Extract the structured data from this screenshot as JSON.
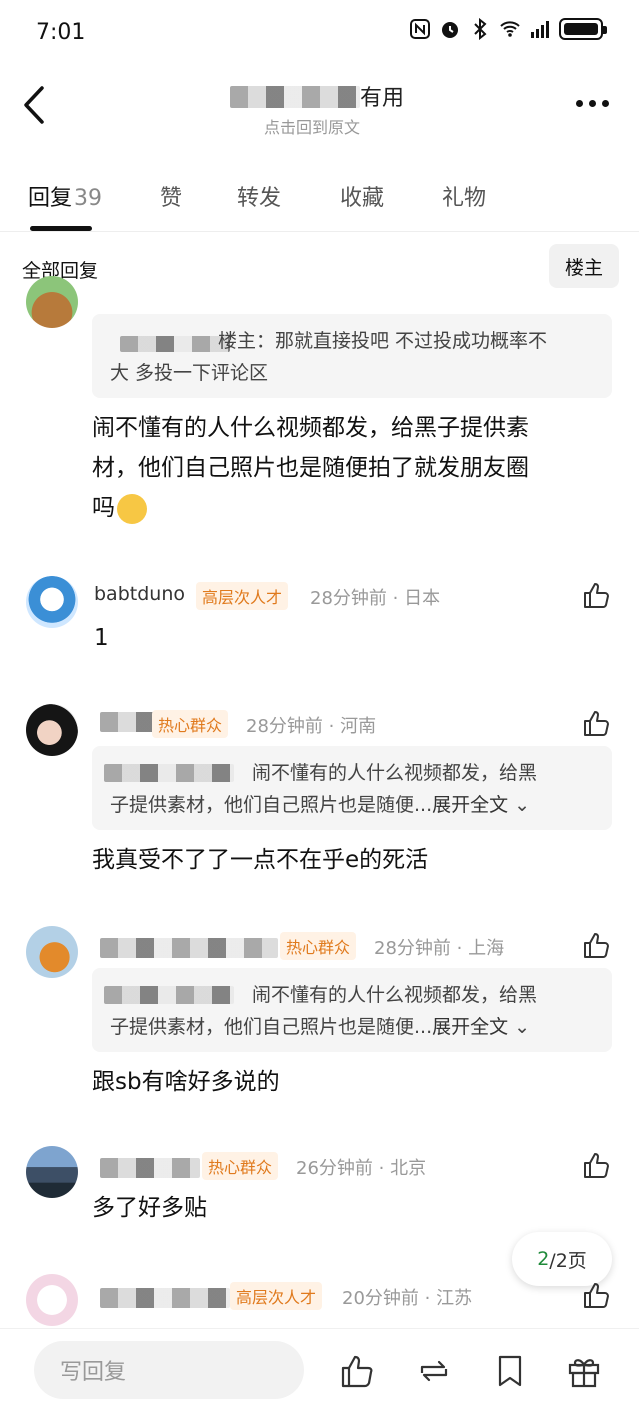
{
  "status_bar": {
    "time": "7:01"
  },
  "header": {
    "title_suffix": "有用",
    "subtitle": "点击回到原文"
  },
  "tabs": [
    {
      "label": "回复",
      "count": "39",
      "active": true
    },
    {
      "label": "赞"
    },
    {
      "label": "转发"
    },
    {
      "label": "收藏"
    },
    {
      "label": "礼物"
    }
  ],
  "filter": {
    "all_label": "全部回复",
    "owner_button": "楼主"
  },
  "comments": [
    {
      "quote_line1": "楼主：那就直接投吧 不过投成功概率不",
      "quote_line2": "大 多投一下评论区",
      "text_line1": "闹不懂有的人什么视频都发，给黑子提供素",
      "text_line2": "材，他们自己照片也是随便拍了就发朋友圈",
      "text_line3": "吗"
    },
    {
      "username": "babtduno",
      "badge": "高层次人才",
      "meta": "28分钟前 · 日本",
      "text": "1"
    },
    {
      "badge": "热心群众",
      "meta": "28分钟前 · 河南",
      "quote_line1": "闹不懂有的人什么视频都发，给黑",
      "quote_line2_text": "子提供素材，他们自己照片也是随便...",
      "quote_expand": "展开全文",
      "text": "我真受不了了一点不在乎e的死活"
    },
    {
      "badge": "热心群众",
      "meta": "28分钟前 · 上海",
      "quote_line1": "闹不懂有的人什么视频都发，给黑",
      "quote_line2_text": "子提供素材，他们自己照片也是随便...",
      "quote_expand": "展开全文",
      "text": "跟sb有啥好多说的"
    },
    {
      "badge": "热心群众",
      "meta": "26分钟前 · 北京",
      "text": "多了好多贴"
    },
    {
      "badge": "高层次人才",
      "meta": "20分钟前 · 江苏"
    }
  ],
  "pagination": {
    "current": "2",
    "total_label": "/2页"
  },
  "bottom_bar": {
    "reply_placeholder": "写回复"
  }
}
